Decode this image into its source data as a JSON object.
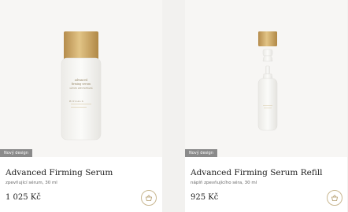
{
  "products": [
    {
      "badge": "Nový design",
      "title": "Advanced Firming Serum",
      "subtitle": "zpevňující sérum, 30 ml",
      "price": "1 025 Kč",
      "bottle_text": [
        "advanced",
        "firming serum",
        "sérum anti-fermeté",
        "RITUALS"
      ]
    },
    {
      "badge": "Nový design",
      "title": "Advanced Firming Serum Refill",
      "subtitle": "náplň zpevňujícího séra, 30 ml",
      "price": "925 Kč"
    }
  ],
  "colors": {
    "gold": "#c7a364",
    "badge_bg": "#8a8a8a",
    "cart_border": "#c9b892"
  },
  "icons": {
    "cart": "basket-icon"
  }
}
